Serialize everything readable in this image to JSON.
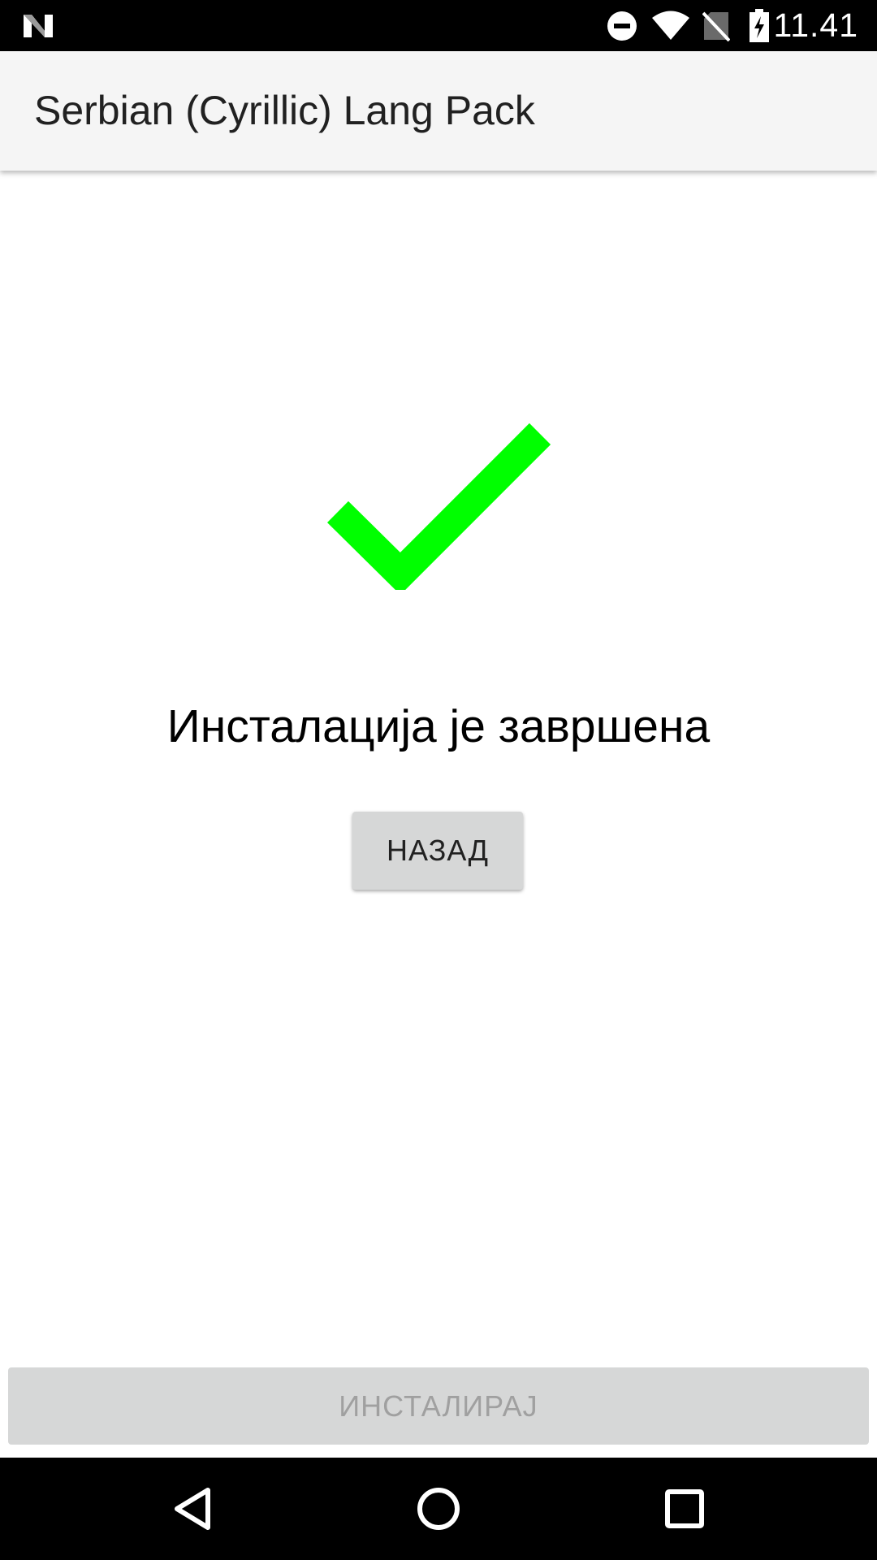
{
  "status_bar": {
    "time": "11.41",
    "icons": [
      "notification-n-icon",
      "do-not-disturb-icon",
      "wifi-icon",
      "no-sim-icon",
      "battery-charging-icon"
    ]
  },
  "app_bar": {
    "title": "Serbian (Cyrillic) Lang Pack"
  },
  "content": {
    "success_icon": "checkmark-icon",
    "success_color": "#00ff00",
    "message": "Инсталација је завршена",
    "back_button_label": "НАЗАД"
  },
  "install_button_label": "ИНСТАЛИРАЈ",
  "nav_bar": {
    "buttons": [
      "back-triangle-icon",
      "home-circle-icon",
      "recents-square-icon"
    ]
  }
}
